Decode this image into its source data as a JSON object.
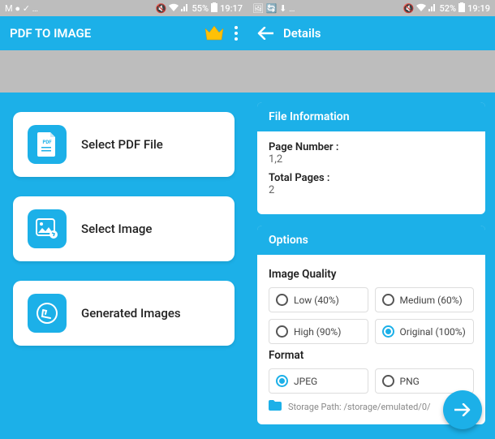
{
  "left": {
    "status": {
      "icons": "M ● ✓ …",
      "battery": "55%",
      "time": "19:17"
    },
    "appbar": {
      "title": "PDF TO IMAGE"
    },
    "actions": {
      "select_pdf": "Select PDF File",
      "select_image": "Select Image",
      "generated": "Generated Images"
    }
  },
  "right": {
    "status": {
      "icons": "🖼 🔄 ⬇ …",
      "battery": "52%",
      "time": "19:19"
    },
    "appbar": {
      "title": "Details"
    },
    "file_info": {
      "header": "File Information",
      "page_number_label": "Page Number :",
      "page_number_value": "1,2",
      "total_pages_label": "Total Pages :",
      "total_pages_value": "2"
    },
    "options": {
      "header": "Options",
      "quality_label": "Image Quality",
      "quality": {
        "low": "Low (40%)",
        "medium": "Medium (60%)",
        "high": "High (90%)",
        "original": "Original (100%)",
        "selected": "original"
      },
      "format_label": "Format",
      "format": {
        "jpeg": "JPEG",
        "png": "PNG",
        "selected": "jpeg"
      },
      "storage_label": "Storage Path: /storage/emulated/0/"
    }
  }
}
